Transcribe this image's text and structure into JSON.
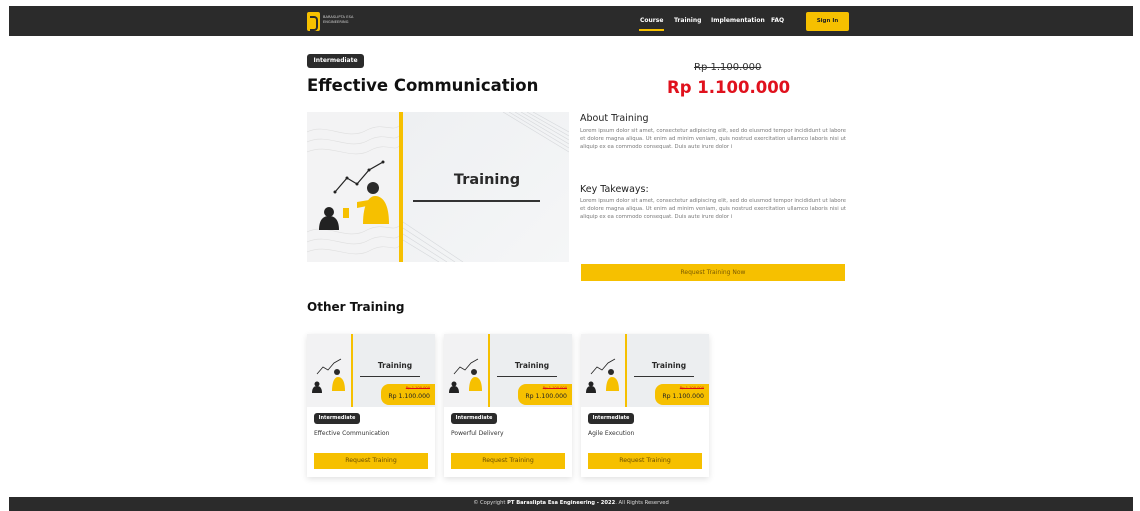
{
  "header": {
    "logo_text": "BARASLIPTA ESA ENGINEERING",
    "nav": [
      "Course",
      "Training",
      "Implementation",
      "FAQ"
    ],
    "signin_label": "Sign In"
  },
  "hero": {
    "level_badge": "Intermediate",
    "title": "Effective Communication",
    "old_price": "Rp 1.100.000",
    "price": "Rp 1.100.000",
    "image_title": "Training",
    "about_title": "About Training",
    "about_text": "Lorem ipsum dolor sit amet, consectetur adipiscing elit, sed do eiusmod tempor incididunt ut labore et dolore magna aliqua. Ut enim ad minim veniam, quis nostrud exercitation ullamco laboris nisi ut aliquip ex ea commodo consequat. Duis aute irure dolor i",
    "takeaways_title": "Key Takeways:",
    "takeaways_text": "Lorem ipsum dolor sit amet, consectetur adipiscing elit, sed do eiusmod tempor incididunt ut labore et dolore magna aliqua. Ut enim ad minim veniam, quis nostrud exercitation ullamco laboris nisi ut aliquip ex ea commodo consequat. Duis aute irure dolor i",
    "request_label": "Request Training Now"
  },
  "other": {
    "title": "Other Training",
    "cards": [
      {
        "image_title": "Training",
        "old_price": "Rp 1.100.000",
        "price": "Rp 1.100.000",
        "level": "Intermediate",
        "name": "Effective Communication",
        "button": "Request Training"
      },
      {
        "image_title": "Training",
        "old_price": "Rp 1.100.000",
        "price": "Rp 1.100.000",
        "level": "Intermediate",
        "name": "Powerful Delivery",
        "button": "Request Training"
      },
      {
        "image_title": "Training",
        "old_price": "Rp 1.100.000",
        "price": "Rp 1.100.000",
        "level": "Intermediate",
        "name": "Agile Execution",
        "button": "Request Training"
      }
    ]
  },
  "footer": {
    "prefix": "© Copyright",
    "company": "PT Baraslipta Esa Engineering - 2022",
    "suffix": ". All Rights Reserved"
  },
  "colors": {
    "accent": "#f6c000",
    "dark": "#2b2b2b",
    "price_red": "#e0111d"
  }
}
